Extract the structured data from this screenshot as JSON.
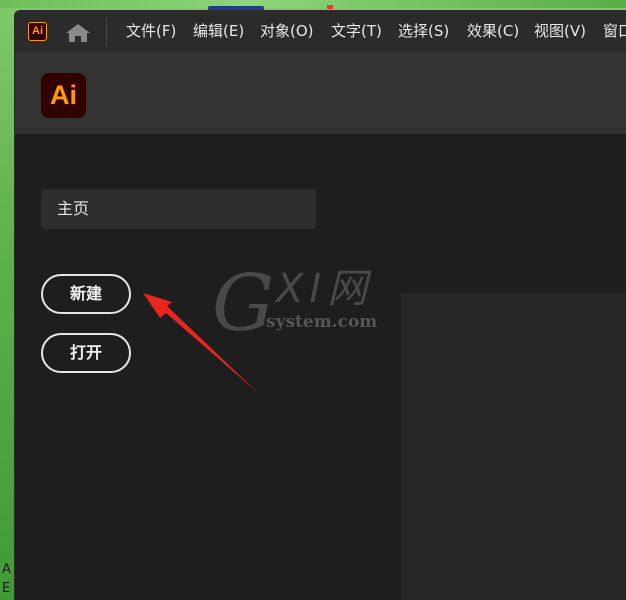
{
  "app": {
    "logo_text": "Ai",
    "menu": [
      "文件(F)",
      "编辑(E)",
      "对象(O)",
      "文字(T)",
      "选择(S)",
      "效果(C)",
      "视图(V)",
      "窗口"
    ]
  },
  "home_screen": {
    "nav_home_label": "主页",
    "new_button_label": "新建",
    "open_button_label": "打开"
  },
  "watermark": {
    "brand": "GXI网",
    "domain": "system.com"
  },
  "desktop": {
    "left_edge_text": [
      "A",
      "E"
    ]
  },
  "colors": {
    "ai_orange": "#ff9a00",
    "ai_dark_red": "#330000",
    "annotation_red": "#e8261f"
  }
}
